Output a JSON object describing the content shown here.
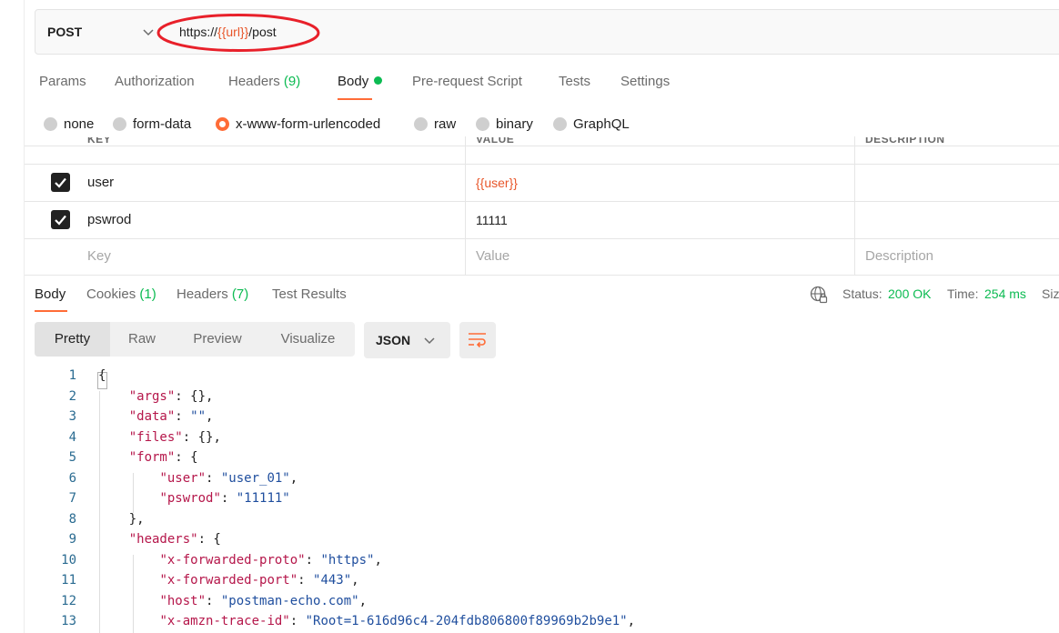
{
  "request": {
    "method": "POST",
    "url_prefix": "https://",
    "url_var": "{{url}}",
    "url_suffix": "/post"
  },
  "request_tabs": {
    "params": "Params",
    "authorization": "Authorization",
    "headers": "Headers",
    "headers_count": "(9)",
    "body": "Body",
    "prerequest": "Pre-request Script",
    "tests": "Tests",
    "settings": "Settings"
  },
  "body_types": {
    "none": "none",
    "form_data": "form-data",
    "urlencoded": "x-www-form-urlencoded",
    "raw": "raw",
    "binary": "binary",
    "graphql": "GraphQL",
    "selected": "x-www-form-urlencoded"
  },
  "params_table": {
    "headers": {
      "key": "KEY",
      "value": "VALUE",
      "description": "DESCRIPTION"
    },
    "rows": [
      {
        "checked": true,
        "key": "user",
        "value": "{{user}}"
      },
      {
        "checked": true,
        "key": "pswrod",
        "value": "11111"
      }
    ],
    "placeholder": {
      "key": "Key",
      "value": "Value",
      "description": "Description"
    }
  },
  "response_tabs": {
    "body": "Body",
    "cookies": "Cookies",
    "cookies_count": "(1)",
    "headers": "Headers",
    "headers_count": "(7)",
    "test_results": "Test Results"
  },
  "response_status": {
    "status_label": "Status:",
    "status_value": "200 OK",
    "time_label": "Time:",
    "time_value": "254 ms",
    "size_label_partial": "Siz"
  },
  "view_toolbar": {
    "pretty": "Pretty",
    "raw": "Raw",
    "preview": "Preview",
    "visualize": "Visualize",
    "format": "JSON"
  },
  "code_lines": [
    {
      "n": "1",
      "parts": [
        [
          "p",
          "{"
        ]
      ]
    },
    {
      "n": "2",
      "parts": [
        [
          "p",
          "    "
        ],
        [
          "k",
          "\"args\""
        ],
        [
          "p",
          ": {},"
        ]
      ]
    },
    {
      "n": "3",
      "parts": [
        [
          "p",
          "    "
        ],
        [
          "k",
          "\"data\""
        ],
        [
          "p",
          ": "
        ],
        [
          "s",
          "\"\""
        ],
        [
          "p",
          ","
        ]
      ]
    },
    {
      "n": "4",
      "parts": [
        [
          "p",
          "    "
        ],
        [
          "k",
          "\"files\""
        ],
        [
          "p",
          ": {},"
        ]
      ]
    },
    {
      "n": "5",
      "parts": [
        [
          "p",
          "    "
        ],
        [
          "k",
          "\"form\""
        ],
        [
          "p",
          ": {"
        ]
      ]
    },
    {
      "n": "6",
      "parts": [
        [
          "p",
          "        "
        ],
        [
          "k",
          "\"user\""
        ],
        [
          "p",
          ": "
        ],
        [
          "s",
          "\"user_01\""
        ],
        [
          "p",
          ","
        ]
      ]
    },
    {
      "n": "7",
      "parts": [
        [
          "p",
          "        "
        ],
        [
          "k",
          "\"pswrod\""
        ],
        [
          "p",
          ": "
        ],
        [
          "s",
          "\"11111\""
        ]
      ]
    },
    {
      "n": "8",
      "parts": [
        [
          "p",
          "    },"
        ]
      ]
    },
    {
      "n": "9",
      "parts": [
        [
          "p",
          "    "
        ],
        [
          "k",
          "\"headers\""
        ],
        [
          "p",
          ": {"
        ]
      ]
    },
    {
      "n": "10",
      "parts": [
        [
          "p",
          "        "
        ],
        [
          "k",
          "\"x-forwarded-proto\""
        ],
        [
          "p",
          ": "
        ],
        [
          "s",
          "\"https\""
        ],
        [
          "p",
          ","
        ]
      ]
    },
    {
      "n": "11",
      "parts": [
        [
          "p",
          "        "
        ],
        [
          "k",
          "\"x-forwarded-port\""
        ],
        [
          "p",
          ": "
        ],
        [
          "s",
          "\"443\""
        ],
        [
          "p",
          ","
        ]
      ]
    },
    {
      "n": "12",
      "parts": [
        [
          "p",
          "        "
        ],
        [
          "k",
          "\"host\""
        ],
        [
          "p",
          ": "
        ],
        [
          "s",
          "\"postman-echo.com\""
        ],
        [
          "p",
          ","
        ]
      ]
    },
    {
      "n": "13",
      "parts": [
        [
          "p",
          "        "
        ],
        [
          "k",
          "\"x-amzn-trace-id\""
        ],
        [
          "p",
          ": "
        ],
        [
          "s",
          "\"Root=1-616d96c4-204fdb806800f89969b2b9e1\""
        ],
        [
          "p",
          ","
        ]
      ]
    }
  ],
  "colors": {
    "accent_orange": "#ff6c37",
    "success_green": "#0cbb52",
    "variable_orange": "#e8562a",
    "annotation_red": "#e8202a",
    "json_key": "#b5164a",
    "json_string": "#1f4e9e",
    "line_number": "#2a6b91"
  },
  "icons": {
    "method_dropdown": "chevron-down-icon",
    "globe": "globe-lock-icon",
    "format_dropdown": "chevron-down-icon",
    "wrap": "wrap-lines-icon",
    "checkbox": "checkmark-icon"
  }
}
